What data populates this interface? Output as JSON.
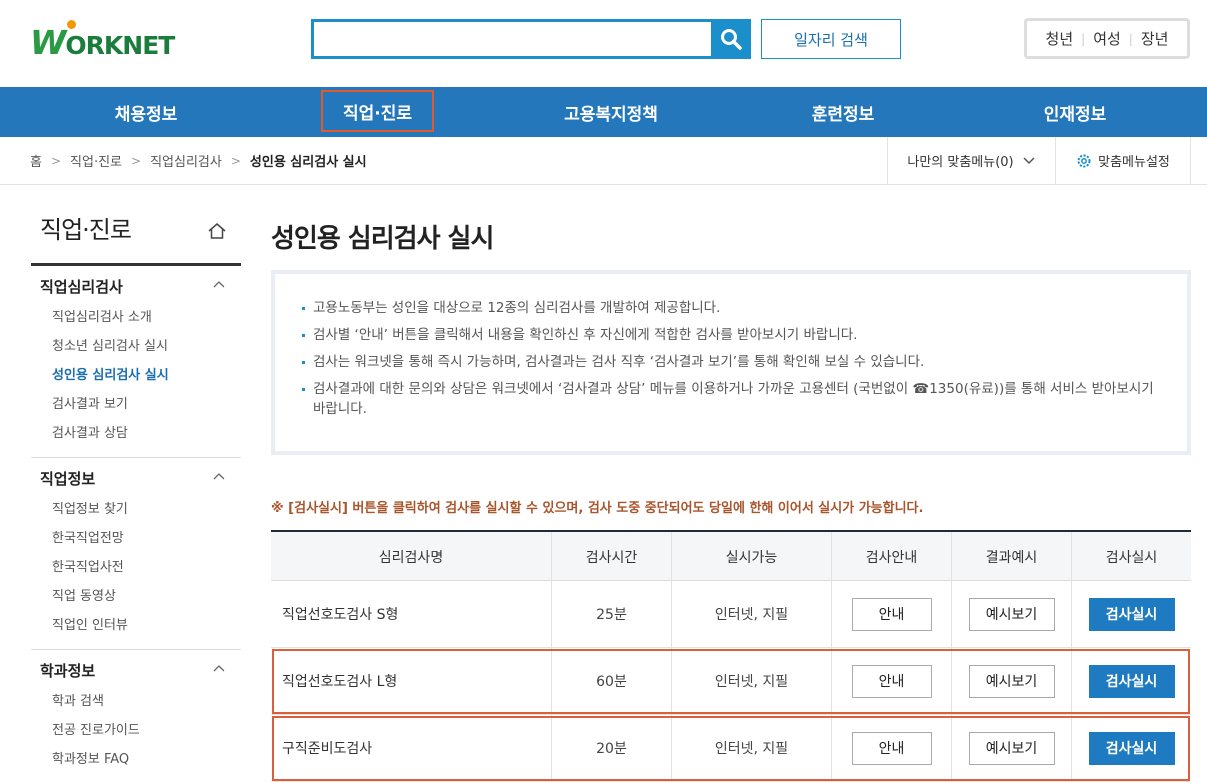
{
  "header": {
    "logo": "WORKNET",
    "search_placeholder": "",
    "job_search_label": "일자리 검색",
    "user_groups": [
      "청년",
      "여성",
      "장년"
    ]
  },
  "gnb": [
    "채용정보",
    "직업·진로",
    "고용복지정책",
    "훈련정보",
    "인재정보"
  ],
  "breadcrumb": {
    "items": [
      "홈",
      "직업·진로",
      "직업심리검사"
    ],
    "current": "성인용 심리검사 실시"
  },
  "my_menu": {
    "label": "나만의 맞춤메뉴(0)",
    "settings_label": "맞춤메뉴설정"
  },
  "sidebar": {
    "title": "직업·진로",
    "groups": [
      {
        "title": "직업심리검사",
        "links": [
          "직업심리검사 소개",
          "청소년 심리검사 실시",
          "성인용 심리검사 실시",
          "검사결과 보기",
          "검사결과 상담"
        ]
      },
      {
        "title": "직업정보",
        "links": [
          "직업정보 찾기",
          "한국직업전망",
          "한국직업사전",
          "직업 동영상",
          "직업인 인터뷰"
        ]
      },
      {
        "title": "학과정보",
        "links": [
          "학과 검색",
          "전공 진로가이드",
          "학과정보 FAQ"
        ]
      }
    ]
  },
  "main": {
    "title": "성인용 심리검사 실시",
    "info": [
      "고용노동부는 성인을 대상으로 12종의 심리검사를 개발하여 제공합니다.",
      "검사별 ‘안내’ 버튼을 클릭해서 내용을 확인하신 후 자신에게 적합한 검사를 받아보시기 바랍니다.",
      "검사는 워크넷을 통해 즉시 가능하며, 검사결과는 검사 직후 ‘검사결과 보기’를 통해 확인해 보실 수 있습니다.",
      "검사결과에 대한 문의와 상담은 워크넷에서 ‘검사결과 상담’ 메뉴를 이용하거나 가까운 고용센터 (국번없이 ☎1350(유료))를 통해 서비스 받아보시기 바랍니다."
    ],
    "note": "※ [검사실시] 버튼을 클릭하여 검사를 실시할 수 있으며, 검사 도중 중단되어도 당일에 한해 이어서 실시가 가능합니다.",
    "table": {
      "headers": [
        "심리검사명",
        "검사시간",
        "실시가능",
        "검사안내",
        "결과예시",
        "검사실시"
      ],
      "rows": [
        {
          "name": "직업선호도검사 S형",
          "time": "25분",
          "mode": "인터넷, 지필",
          "guide": "안내",
          "example": "예시보기",
          "start": "검사실시"
        },
        {
          "name": "직업선호도검사 L형",
          "time": "60분",
          "mode": "인터넷, 지필",
          "guide": "안내",
          "example": "예시보기",
          "start": "검사실시"
        },
        {
          "name": "구직준비도검사",
          "time": "20분",
          "mode": "인터넷, 지필",
          "guide": "안내",
          "example": "예시보기",
          "start": "검사실시"
        }
      ]
    }
  },
  "colors": {
    "primary": "#2477bb",
    "highlight": "#d9603a",
    "note": "#a9542b"
  }
}
